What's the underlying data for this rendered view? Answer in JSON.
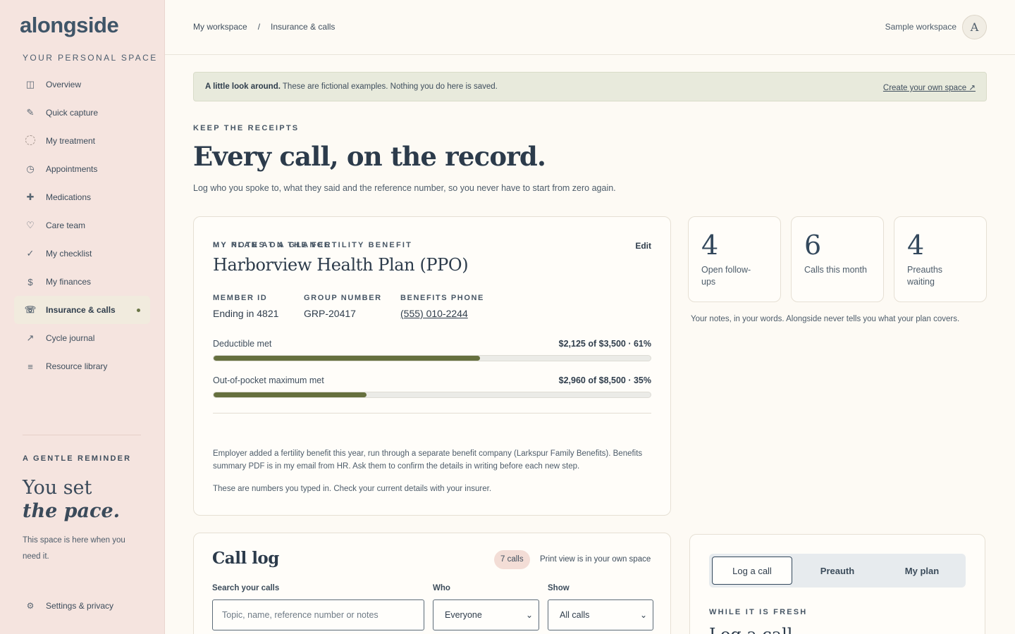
{
  "app": {
    "logo": "alongside",
    "caption": "YOUR PERSONAL SPACE"
  },
  "sidebar": {
    "items": [
      {
        "label": "Overview",
        "icon": "layout-icon",
        "glyph": "◫"
      },
      {
        "label": "Quick capture",
        "icon": "pencil-icon",
        "glyph": "✎"
      },
      {
        "label": "My treatment",
        "icon": "circle-icon",
        "glyph": ""
      },
      {
        "label": "Appointments",
        "icon": "clock-icon",
        "glyph": "◷"
      },
      {
        "label": "Medications",
        "icon": "plus-icon",
        "glyph": "✚"
      },
      {
        "label": "Care team",
        "icon": "heart-icon",
        "glyph": "♡"
      },
      {
        "label": "My checklist",
        "icon": "check-icon",
        "glyph": "✓"
      },
      {
        "label": "My finances",
        "icon": "dollar-icon",
        "glyph": "$"
      },
      {
        "label": "Insurance & calls",
        "icon": "phone-icon",
        "glyph": "☏",
        "active": true
      },
      {
        "label": "Cycle journal",
        "icon": "trend-icon",
        "glyph": "↗"
      },
      {
        "label": "Resource library",
        "icon": "list-icon",
        "glyph": "≡"
      }
    ],
    "reminder": {
      "caption": "A GENTLE REMINDER",
      "line1": "You set",
      "line2": "the pace.",
      "text": "This space is here when you need it."
    },
    "settings": {
      "label": "Settings & privacy",
      "glyph": "⚙"
    }
  },
  "topbar": {
    "crumb1": "My workspace",
    "sep": "/",
    "crumb2": "Insurance & calls",
    "workspace": "Sample workspace",
    "avatar": "A"
  },
  "banner": {
    "bold": "A little look around.",
    "text": " These are fictional examples. Nothing you do here is saved.",
    "link": "Create your own space ↗"
  },
  "hero": {
    "eyebrow": "KEEP THE RECEIPTS",
    "title": "Every call, on the record.",
    "subtitle": "Log who you spoke to, what they said and the reference number, so you never have to start from zero again."
  },
  "plan": {
    "eyebrow": "MY PLAN AT A GLANCE",
    "edit": "Edit",
    "name": "Harborview Health Plan (PPO)",
    "member_label": "MEMBER ID",
    "member_value": "Ending in 4821",
    "group_label": "GROUP NUMBER",
    "group_value": "GRP-20417",
    "phone_label": "BENEFITS PHONE",
    "phone_value": "(555) 010-2244",
    "deductible_label": "Deductible met",
    "deductible_value": "$2,125 of $3,500 · 61%",
    "deductible_fraction": 0.61,
    "oop_label": "Out-of-pocket maximum met",
    "oop_value": "$2,960 of $8,500 · 35%",
    "oop_fraction": 0.35,
    "notes_eyebrow": "MY NOTES ON THE FERTILITY BENEFIT",
    "notes_text": "Employer added a fertility benefit this year, run through a separate benefit company (Larkspur Family Benefits). Benefits summary PDF is in my email from HR. Ask them to confirm the details in writing before each new step.",
    "notes_fine": "These are numbers you typed in. Check your current details with your insurer."
  },
  "stats": [
    {
      "num": "4",
      "label": "Open follow-ups"
    },
    {
      "num": "6",
      "label": "Calls this month"
    },
    {
      "num": "4",
      "label": "Preauths waiting"
    }
  ],
  "stats_note": "Your notes, in your words. Alongside never tells you what your plan covers.",
  "calllog": {
    "title": "Call log",
    "count": "7 calls",
    "print_note": "Print view is in your own space",
    "search_label": "Search your calls",
    "search_placeholder": "Topic, name, reference number or notes",
    "who_label": "Who",
    "who_value": "Everyone",
    "show_label": "Show",
    "show_value": "All calls"
  },
  "form": {
    "tabs": [
      "Log a call",
      "Preauth",
      "My plan"
    ],
    "fresh": "WHILE IT IS FRESH",
    "peek": "Log a call"
  },
  "colors": {
    "accent": "#66703f",
    "sidebar_bg": "#f5e4df",
    "page_bg": "#fdfaf4",
    "text": "#2f3d4c"
  }
}
